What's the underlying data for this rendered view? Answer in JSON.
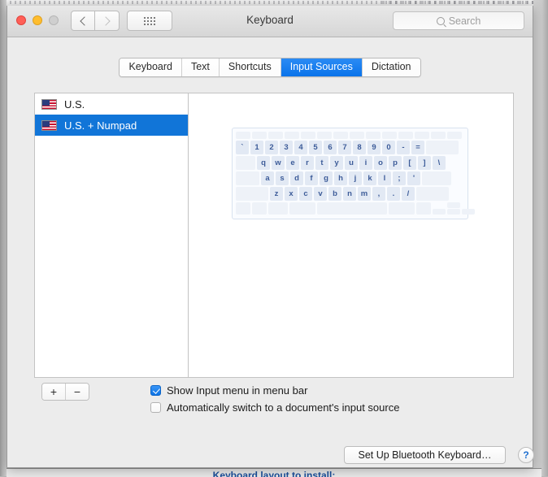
{
  "desktop": {
    "background_window_cut_label": "Keyboard layout to install:"
  },
  "window": {
    "title": "Keyboard",
    "traffic_lights": {
      "close": "close-button",
      "minimize": "minimize-button",
      "zoom": "zoom-button"
    },
    "toolbar": {
      "back_label": "",
      "forward_label": "",
      "show_all_label": "",
      "search": {
        "placeholder": "Search",
        "value": ""
      }
    }
  },
  "tabs": [
    {
      "label": "Keyboard",
      "active": false
    },
    {
      "label": "Text",
      "active": false
    },
    {
      "label": "Shortcuts",
      "active": false
    },
    {
      "label": "Input Sources",
      "active": true
    },
    {
      "label": "Dictation",
      "active": false
    }
  ],
  "input_sources": [
    {
      "label": "U.S.",
      "flag": "us-flag-icon",
      "selected": false
    },
    {
      "label": "U.S. + Numpad",
      "flag": "us-flag-icon",
      "selected": true
    }
  ],
  "keyboard_preview": {
    "rows": [
      {
        "type": "fn",
        "keys": [
          "",
          "",
          "",
          "",
          "",
          "",
          "",
          "",
          "",
          "",
          "",
          "",
          "",
          ""
        ]
      },
      {
        "type": "num",
        "keys": [
          "`",
          "1",
          "2",
          "3",
          "4",
          "5",
          "6",
          "7",
          "8",
          "9",
          "0",
          "-",
          "=",
          ""
        ]
      },
      {
        "type": "top",
        "keys": [
          "",
          "q",
          "w",
          "e",
          "r",
          "t",
          "y",
          "u",
          "i",
          "o",
          "p",
          "[",
          "]",
          "\\"
        ]
      },
      {
        "type": "home",
        "keys": [
          "",
          "a",
          "s",
          "d",
          "f",
          "g",
          "h",
          "j",
          "k",
          "l",
          ";",
          "'",
          ""
        ]
      },
      {
        "type": "bot",
        "keys": [
          "",
          "z",
          "x",
          "c",
          "v",
          "b",
          "n",
          "m",
          ",",
          ".",
          "/",
          ""
        ]
      },
      {
        "type": "mod",
        "keys": [
          "",
          "",
          "",
          "",
          "",
          "",
          "",
          ""
        ]
      }
    ]
  },
  "list_buttons": {
    "add_label": "+",
    "remove_label": "−"
  },
  "options": [
    {
      "label": "Show Input menu in menu bar",
      "checked": true
    },
    {
      "label": "Automatically switch to a document's input source",
      "checked": false
    }
  ],
  "footer": {
    "bluetooth_button_label": "Set Up Bluetooth Keyboard…",
    "help_label": "?"
  },
  "colors": {
    "accent_blue": "#1175d8",
    "tab_active_blue": "#0a73ea",
    "key_text_blue": "#3d5c99",
    "key_face": "#e2e9f4",
    "help_blue": "#1f6fd0"
  }
}
